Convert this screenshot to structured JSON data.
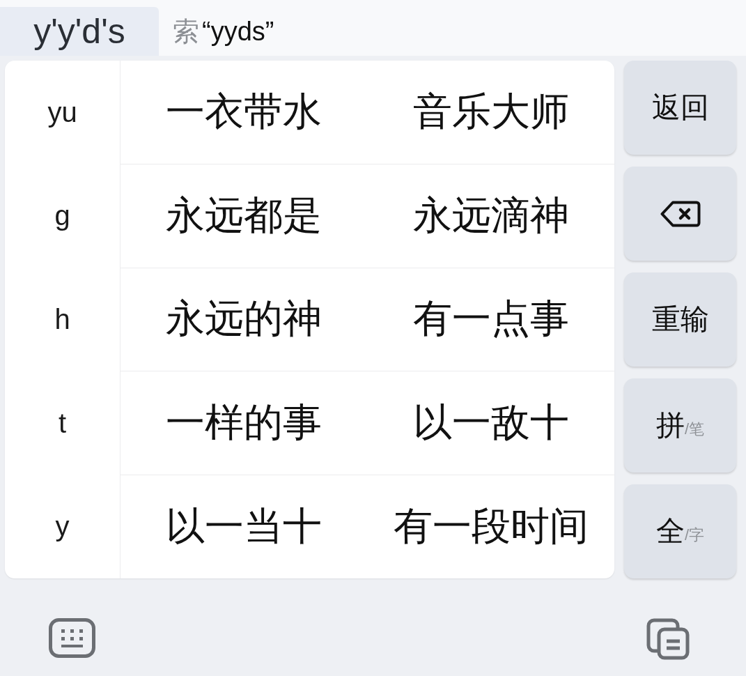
{
  "composition": {
    "text": "y'y'd's"
  },
  "suggestion": {
    "prompt": "索",
    "query": "“yyds”"
  },
  "pinyin_filters": [
    {
      "label": "yu"
    },
    {
      "label": "g"
    },
    {
      "label": "h"
    },
    {
      "label": "t"
    },
    {
      "label": "y"
    }
  ],
  "candidates": [
    "一衣带水",
    "音乐大师",
    "永远都是",
    "永远滴神",
    "永远的神",
    "有一点事",
    "一样的事",
    "以一敌十",
    "以一当十",
    "有一段时间"
  ],
  "keys": [
    {
      "kind": "text",
      "label": "返回"
    },
    {
      "kind": "backspace"
    },
    {
      "kind": "text",
      "label": "重输"
    },
    {
      "kind": "toggle",
      "label": "拼",
      "alt": "/笔"
    },
    {
      "kind": "toggle",
      "label": "全",
      "alt": "/字"
    }
  ]
}
